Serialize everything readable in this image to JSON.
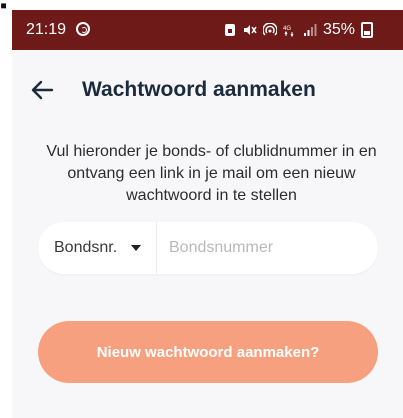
{
  "status_bar": {
    "time": "21:19",
    "battery": "35%",
    "icons": [
      "whatsapp-icon",
      "sim-icon",
      "mute-icon",
      "hotspot-icon",
      "4g-icon",
      "signal-icon",
      "battery-icon"
    ],
    "background": "#6e1a18"
  },
  "header": {
    "title": "Wachtwoord aanmaken",
    "back_icon": "arrow-left-icon"
  },
  "description": "Vul hieronder je bonds- of clublidnummer in en ontvang een link in je mail om een nieuw wachtwoord in te stellen",
  "form": {
    "type_select": {
      "selected": "Bondsnr."
    },
    "member_input": {
      "placeholder": "Bondsnummer",
      "value": ""
    },
    "submit_label": "Nieuw wachtwoord aanmaken?",
    "accent": "#f7a07f"
  }
}
